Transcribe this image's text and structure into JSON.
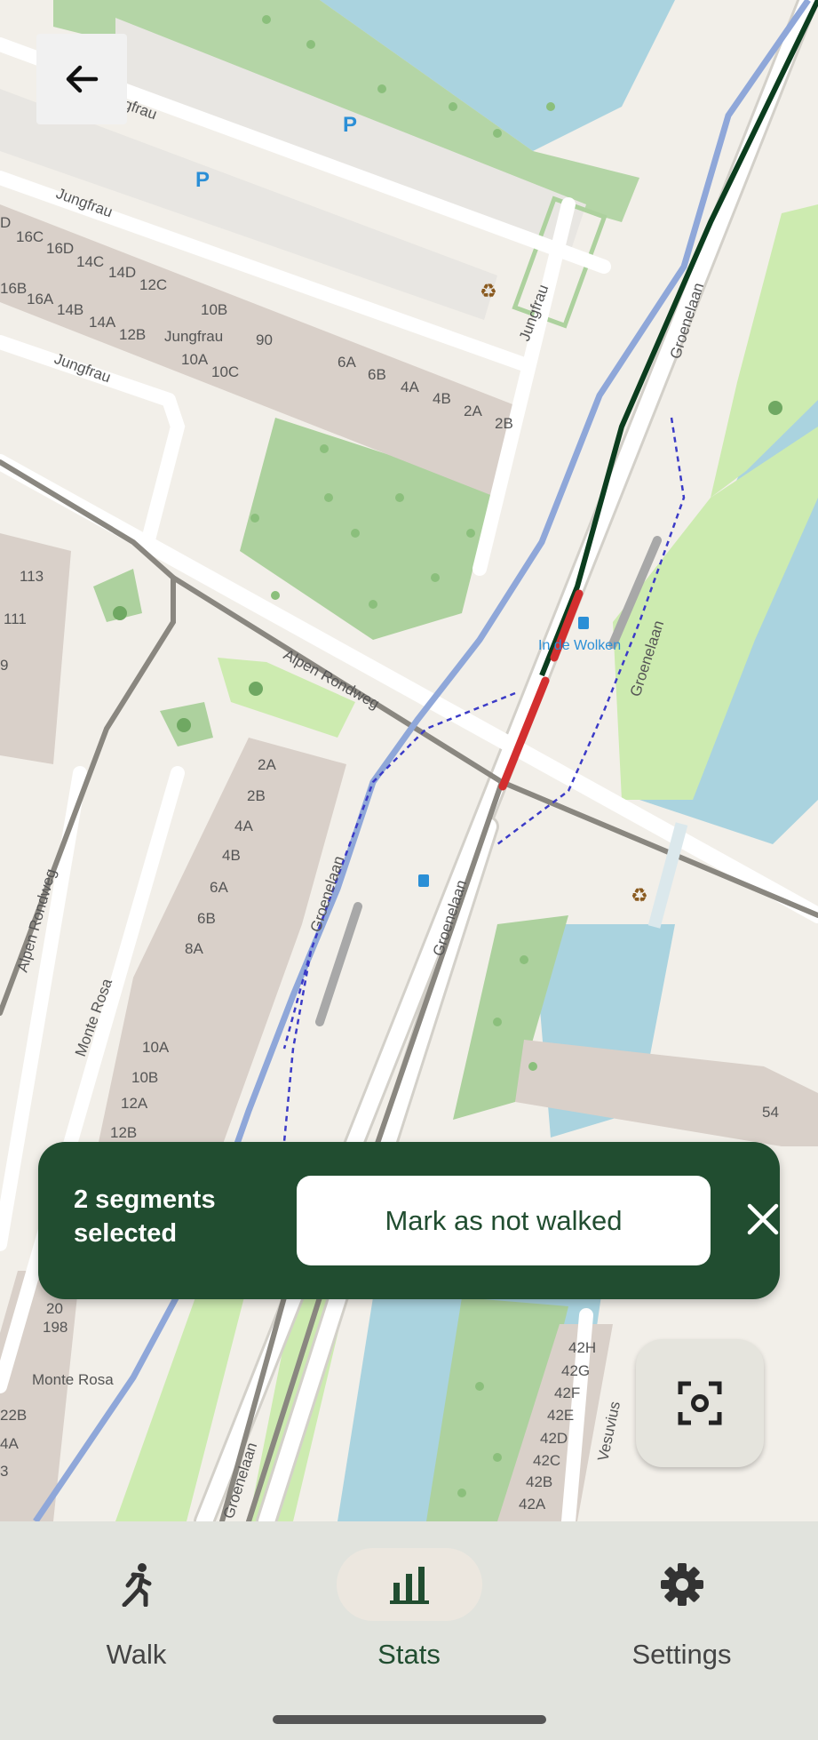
{
  "map": {
    "street_labels": {
      "jungfrau_1": "Jungfrau",
      "jungfrau_2": "Jungfrau",
      "jungfrau_3": "Jungfrau",
      "jungfrau_4": "Jungfrau",
      "jungfrau_5": "Jungfrau",
      "alpen_rondweg_1": "Alpen Rondweg",
      "alpen_rondweg_2": "Alpen Rondweg",
      "groenelaan_1": "Groenelaan",
      "groenelaan_2": "Groenelaan",
      "groenelaan_3": "Groenelaan",
      "groenelaan_4": "Groenelaan",
      "groenelaan_5": "Groenelaan",
      "monte_rosa_1": "Monte Rosa",
      "monte_rosa_2": "Monte Rosa",
      "vesuvius": "Vesuvius",
      "bus_stop": "In de Wolken"
    },
    "house_numbers": {
      "h16c": "16C",
      "h16d": "16D",
      "h14c": "14C",
      "h14d": "14D",
      "h12c": "12C",
      "h16b": "16B",
      "h16a": "16A",
      "h14b": "14B",
      "h14a": "14A",
      "h12b": "12B",
      "h10b": "10B",
      "h10a": "10A",
      "h10c": "10C",
      "h90": "90",
      "h6a": "6A",
      "h6b": "6B",
      "h4a": "4A",
      "h4b": "4B",
      "h2a": "2A",
      "h2b": "2B",
      "h113": "113",
      "h111": "111",
      "hd": "D",
      "h9": "9",
      "c2a": "2A",
      "c2b": "2B",
      "c4a": "4A",
      "c4b": "4B",
      "c6a": "6A",
      "c6b": "6B",
      "c8a": "8A",
      "c10a": "10A",
      "c10b": "10B",
      "c12a": "12A",
      "c12b": "12B",
      "h20": "20",
      "h198": "198",
      "h22b": "22B",
      "h4a2": "4A",
      "h3": "3",
      "h54": "54",
      "v42h": "42H",
      "v42g": "42G",
      "v42f": "42F",
      "v42e": "42E",
      "v42d": "42D",
      "v42c": "42C",
      "v42b": "42B",
      "v42a": "42A"
    },
    "parking_symbol": "P"
  },
  "back_button": {
    "icon": "arrow-left-icon"
  },
  "selection": {
    "text": "2 segments selected",
    "action_label": "Mark as not walked",
    "close_icon": "close-icon"
  },
  "recenter_button": {
    "icon": "focus-target-icon"
  },
  "nav": {
    "items": [
      {
        "label": "Walk",
        "icon": "walk-icon",
        "active": false
      },
      {
        "label": "Stats",
        "icon": "bar-chart-icon",
        "active": true
      },
      {
        "label": "Settings",
        "icon": "gear-icon",
        "active": false
      }
    ]
  },
  "colors": {
    "accent_dark_green": "#214d30",
    "selected_segment_red": "#d32f2f",
    "walked_segment_green": "#0b3d1e",
    "water": "#aad3df",
    "park": "#add19e",
    "building": "#d9d0c9",
    "nav_background": "#e1e3dd"
  }
}
